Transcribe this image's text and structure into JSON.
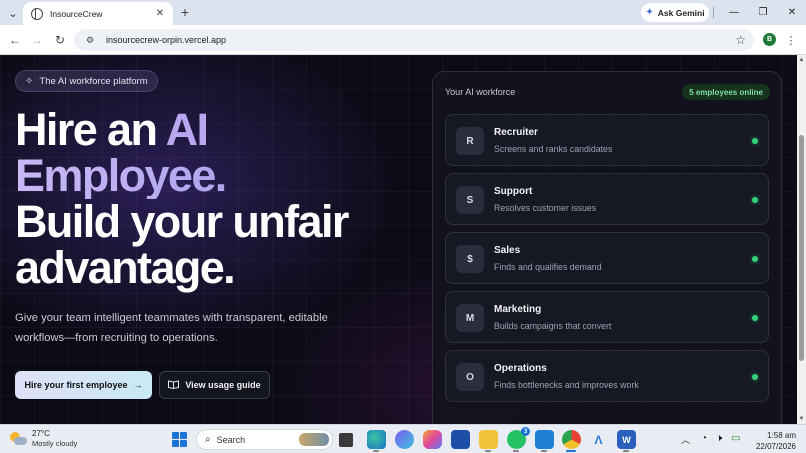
{
  "browser": {
    "tab_title": "InsourceCrew",
    "tab_close": "✕",
    "new_tab": "+",
    "gemini_label": "Ask Gemini",
    "url": "insourcecrew-orpin.vercel.app",
    "profile_initial": "B",
    "window_controls": {
      "minimize": "—",
      "restore": "❐",
      "close": "✕"
    }
  },
  "hero": {
    "pill_label": "The AI workforce platform",
    "headline": {
      "line1_plain": "Hire an ",
      "line1_accent": "AI",
      "line2_accent": "Employee.",
      "line3": "Build your unfair",
      "line4": "advantage."
    },
    "subtext": "Give your team intelligent teammates with transparent, editable workflows—from recruiting to operations.",
    "primary_cta": "Hire your first employee",
    "secondary_cta": "View usage guide"
  },
  "workforce": {
    "title": "Your AI workforce",
    "online_badge": "5 employees online",
    "employees": [
      {
        "initial": "R",
        "name": "Recruiter",
        "desc": "Screens and ranks candidates"
      },
      {
        "initial": "S",
        "name": "Support",
        "desc": "Resolves customer issues"
      },
      {
        "initial": "$",
        "name": "Sales",
        "desc": "Finds and qualifies demand"
      },
      {
        "initial": "M",
        "name": "Marketing",
        "desc": "Builds campaigns that convert"
      },
      {
        "initial": "O",
        "name": "Operations",
        "desc": "Finds bottlenecks and improves work"
      }
    ]
  },
  "taskbar": {
    "weather_temp": "27°C",
    "weather_cond": "Mostly cloudy",
    "search_label": "Search",
    "whatsapp_badge": "3",
    "time": "1:58 am",
    "date": "22/07/2026"
  },
  "colors": {
    "page_bg": "#0a0b14",
    "accent_purple": "#b9a7ef",
    "online_green": "#34d27a",
    "badge_text": "#7ee0a1"
  }
}
